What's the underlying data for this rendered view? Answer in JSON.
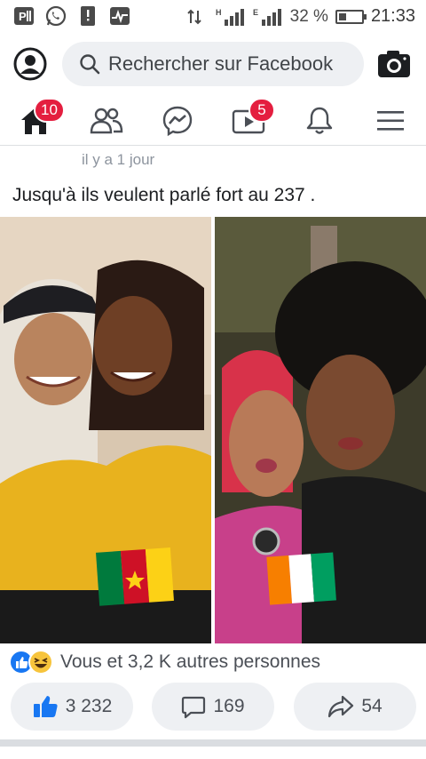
{
  "status_bar": {
    "battery": "32 %",
    "battery_level": 0.32,
    "time": "21:33",
    "left_icons": [
      "pinterest-icon",
      "whatsapp-icon",
      "sim-notification-icon",
      "activity-icon"
    ],
    "right_icons": [
      "data-arrows-icon",
      "signal-h-icon",
      "signal-e-icon"
    ]
  },
  "header": {
    "search_placeholder": "Rechercher sur Facebook"
  },
  "nav": {
    "items": [
      {
        "name": "home",
        "badge": "10",
        "active": true
      },
      {
        "name": "friends",
        "badge": ""
      },
      {
        "name": "messenger",
        "badge": ""
      },
      {
        "name": "watch",
        "badge": "5"
      },
      {
        "name": "notifications",
        "badge": ""
      },
      {
        "name": "menu",
        "badge": ""
      }
    ]
  },
  "post": {
    "timestamp": "il y a 1 jour",
    "text": "Jusqu'à ils veulent parlé fort au 237 .",
    "reactions_text": "Vous et 3,2 K autres personnes",
    "like_count": "3 232",
    "comment_count": "169",
    "share_count": "54"
  },
  "colors": {
    "facebook_blue": "#1877f2",
    "badge_red": "#e41e3f",
    "button_bg": "#eef0f3"
  }
}
